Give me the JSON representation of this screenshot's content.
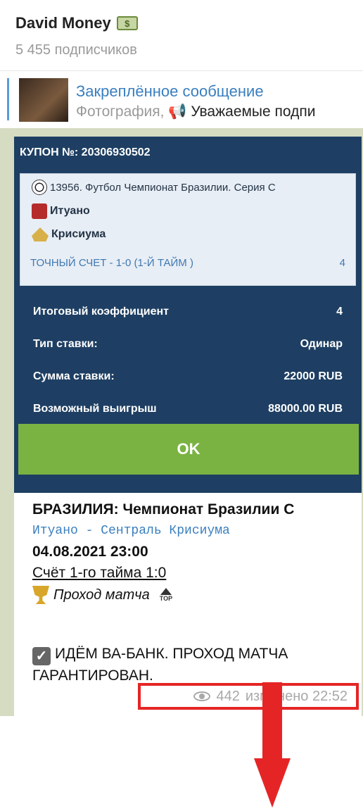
{
  "channel": {
    "name": "David Money",
    "icon": "money-banknote-icon",
    "subscribers": "5 455 подписчиков"
  },
  "pinned": {
    "title": "Закреплённое сообщение",
    "media": "Фотография,",
    "icon": "megaphone-icon",
    "text": "Уважаемые подпи"
  },
  "coupon": {
    "number": "КУПОН №: 20306930502",
    "event": "13956. Футбол Чемпионат Бразилии. Серия С",
    "team1": "Итуано",
    "team2": "Крисиума",
    "bet": "ТОЧНЫЙ СЧЕТ - 1-0 (1-Й ТАЙМ )",
    "bet_value": "4",
    "summary": [
      {
        "label": "Итоговый коэффициент",
        "value": "4"
      },
      {
        "label": "Тип ставки:",
        "value": "Одинар"
      },
      {
        "label": "Сумма ставки:",
        "value": "22000 RUB"
      },
      {
        "label": "Возможный выигрыш",
        "value": "88000.00 RUB"
      }
    ],
    "ok_label": "OK"
  },
  "message": {
    "league": "БРАЗИЛИЯ: Чемпионат Бразилии С",
    "teams": "Итуано - Сентраль Крисиума",
    "datetime": "04.08.2021 23:00",
    "score": "Счёт 1-го тайма 1:0",
    "pass": "Проход матча",
    "top_label": "TOP",
    "vabank": "ИДЁМ ВА-БАНК. ПРОХОД МАТЧА ГАРАНТИРОВАН.",
    "views": "442",
    "edited": "изменено 22:52"
  },
  "colors": {
    "coupon_bg": "#1e3f63",
    "ok_green": "#7ab342",
    "highlight_red": "#e52525",
    "link_blue": "#3a7fbf"
  }
}
